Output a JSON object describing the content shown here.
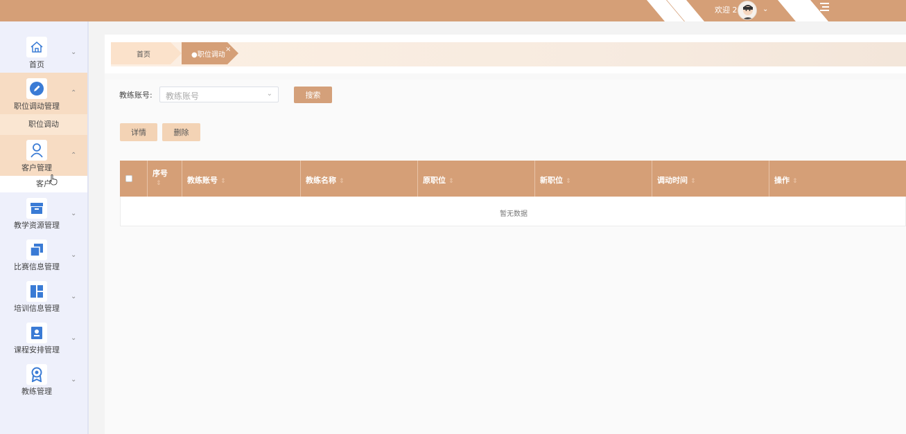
{
  "header": {
    "welcome": "欢迎 2",
    "colors": {
      "bar": "#d59f77",
      "accent": "#d4a07a"
    }
  },
  "sidebar": {
    "items": [
      {
        "label": "首页",
        "icon": "home-icon"
      },
      {
        "label": "职位调动管理",
        "icon": "edit-icon",
        "submenu": "职位调动"
      },
      {
        "label": "客户管理",
        "icon": "user-icon",
        "submenu": "客户"
      },
      {
        "label": "教学资源管理",
        "icon": "archive-icon"
      },
      {
        "label": "比赛信息管理",
        "icon": "copy-icon"
      },
      {
        "label": "培训信息管理",
        "icon": "dashboard-icon"
      },
      {
        "label": "课程安排管理",
        "icon": "badge-icon"
      },
      {
        "label": "教练管理",
        "icon": "medal-icon"
      }
    ]
  },
  "tabs": {
    "home": "首页",
    "active": "●职位调动",
    "close": "×"
  },
  "search": {
    "label": "教练账号:",
    "placeholder": "教练账号",
    "button": "搜索"
  },
  "actions": {
    "detail": "详情",
    "delete": "删除"
  },
  "table": {
    "columns": [
      "序号",
      "教练账号",
      "教练名称",
      "原职位",
      "新职位",
      "调动时间",
      "操作"
    ],
    "empty_text": "暂无数据"
  }
}
